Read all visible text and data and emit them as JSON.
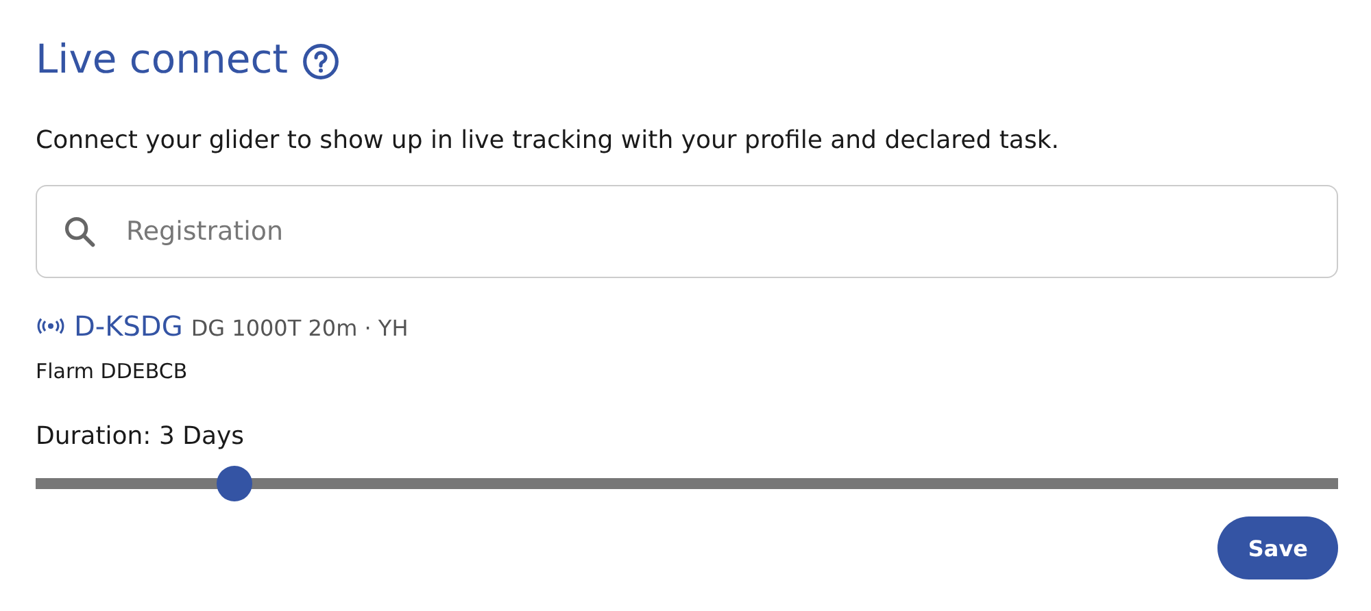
{
  "title": "Live connect",
  "description": "Connect your glider to show up in live tracking with your profile and declared task.",
  "search": {
    "placeholder": "Registration"
  },
  "glider": {
    "registration": "D-KSDG",
    "details": "DG 1000T 20m · YH",
    "flarm": "Flarm DDEBCB"
  },
  "duration": {
    "label": "Duration: 3 Days",
    "level": 0.153
  },
  "buttons": [
    "Save"
  ]
}
